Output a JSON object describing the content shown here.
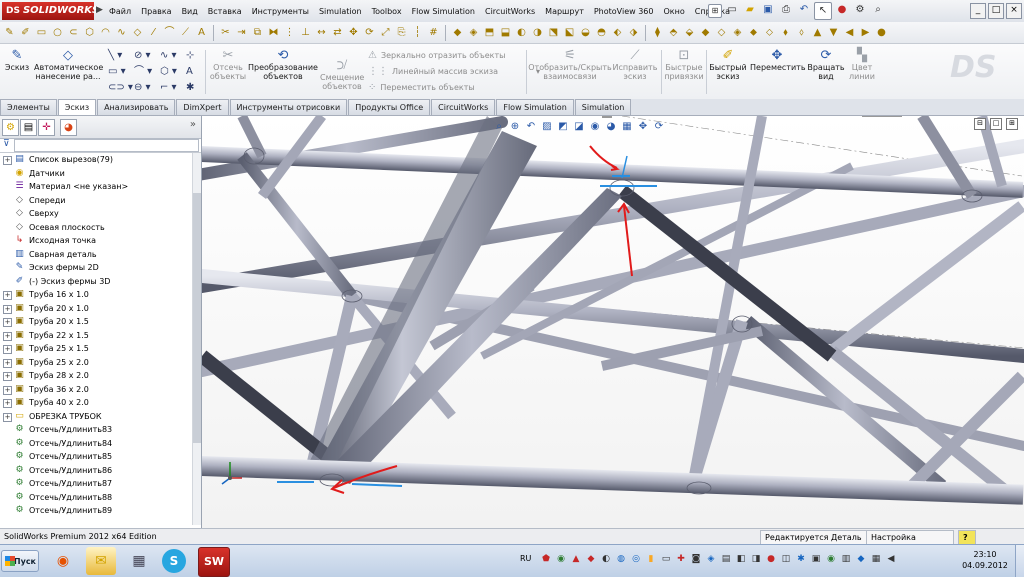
{
  "app": {
    "logo_text": "SOLIDWORKS",
    "logo_mark": "DS",
    "menu": [
      "Файл",
      "Правка",
      "Вид",
      "Вставка",
      "Инструменты",
      "Simulation",
      "Toolbox",
      "Flow Simulation",
      "CircuitWorks",
      "Маршрут",
      "PhotoView 360",
      "Окно",
      "Справка"
    ],
    "window_controls": [
      "_",
      "□",
      "×"
    ]
  },
  "command_manager": {
    "buttons": {
      "sketch": "Эскиз",
      "auto_dim": "Автоматическое нанесение ра...",
      "trim": "Отсечь объекты",
      "convert": "Преобразование объектов",
      "offset": "Смещение объектов",
      "show_hide_relations": "Отобразить/Скрыть взаимосвязи",
      "repair_sketch": "Исправить эскиз",
      "quick_snaps": "Быстрые привязки",
      "rapid_sketch": "Быстрый эскиз",
      "move": "Переместить",
      "rotate_view": "Вращать вид",
      "line_color": "Цвет линии"
    },
    "mirror": "Зеркально отразить объекты",
    "linear_pattern": "Линейный массив эскиза",
    "move_entities": "Переместить объекты"
  },
  "tabs": [
    "Элементы",
    "Эскиз",
    "Анализировать",
    "DimXpert",
    "Инструменты отрисовки",
    "Продукты Office",
    "CircuitWorks",
    "Flow Simulation",
    "Simulation"
  ],
  "active_tab": "Эскиз",
  "tree": {
    "items": [
      {
        "label": "Список вырезов(79)",
        "icon": "cutlist-icon",
        "expand": "+"
      },
      {
        "label": "Датчики",
        "icon": "sensor-icon",
        "expand": ""
      },
      {
        "label": "Материал <не указан>",
        "icon": "material-icon",
        "expand": ""
      },
      {
        "label": "Спереди",
        "icon": "plane-icon",
        "expand": ""
      },
      {
        "label": "Сверху",
        "icon": "plane-icon",
        "expand": ""
      },
      {
        "label": "Осевая плоскость",
        "icon": "plane-icon",
        "expand": ""
      },
      {
        "label": "Исходная точка",
        "icon": "origin-icon",
        "expand": ""
      },
      {
        "label": "Сварная деталь",
        "icon": "weldment-icon",
        "expand": ""
      },
      {
        "label": "Эскиз фермы 2D",
        "icon": "sketch-icon",
        "expand": ""
      },
      {
        "label": "(-) Эскиз фермы 3D",
        "icon": "sketch3d-icon",
        "expand": ""
      },
      {
        "label": "Труба 16 x 1.0",
        "icon": "member-icon",
        "expand": "+"
      },
      {
        "label": "Труба 20 x 1.0",
        "icon": "member-icon",
        "expand": "+"
      },
      {
        "label": "Труба 20 x 1.5",
        "icon": "member-icon",
        "expand": "+"
      },
      {
        "label": "Труба 22 x 1.5",
        "icon": "member-icon",
        "expand": "+"
      },
      {
        "label": "Труба 25 x 1.5",
        "icon": "member-icon",
        "expand": "+"
      },
      {
        "label": "Труба 25 x 2.0",
        "icon": "member-icon",
        "expand": "+"
      },
      {
        "label": "Труба 28 x 2.0",
        "icon": "member-icon",
        "expand": "+"
      },
      {
        "label": "Труба 36 x 2.0",
        "icon": "member-icon",
        "expand": "+"
      },
      {
        "label": "Труба 40 x 2.0",
        "icon": "member-icon",
        "expand": "+"
      },
      {
        "label": "ОБРЕЗКА ТРУБОК",
        "icon": "folder-icon",
        "expand": "+"
      },
      {
        "label": "Отсечь/Удлинить83",
        "icon": "trim-extend-icon",
        "expand": ""
      },
      {
        "label": "Отсечь/Удлинить84",
        "icon": "trim-extend-icon",
        "expand": ""
      },
      {
        "label": "Отсечь/Удлинить85",
        "icon": "trim-extend-icon",
        "expand": ""
      },
      {
        "label": "Отсечь/Удлинить86",
        "icon": "trim-extend-icon",
        "expand": ""
      },
      {
        "label": "Отсечь/Удлинить87",
        "icon": "trim-extend-icon",
        "expand": ""
      },
      {
        "label": "Отсечь/Удлинить88",
        "icon": "trim-extend-icon",
        "expand": ""
      },
      {
        "label": "Отсечь/Удлинить89",
        "icon": "trim-extend-icon",
        "expand": ""
      }
    ]
  },
  "status": {
    "edition": "SolidWorks Premium 2012 x64 Edition",
    "editing": "Редактируется Деталь",
    "settings": "Настройка",
    "help": "?"
  },
  "taskbar": {
    "start": "Пуск",
    "lang": "RU",
    "time": "23:10",
    "date": "04.09.2012"
  },
  "colors": {
    "tube_light": "#b9bccb",
    "tube_dark": "#4d5060",
    "annotation_red": "#e11b1b",
    "annotation_blue": "#2a8fe0"
  }
}
